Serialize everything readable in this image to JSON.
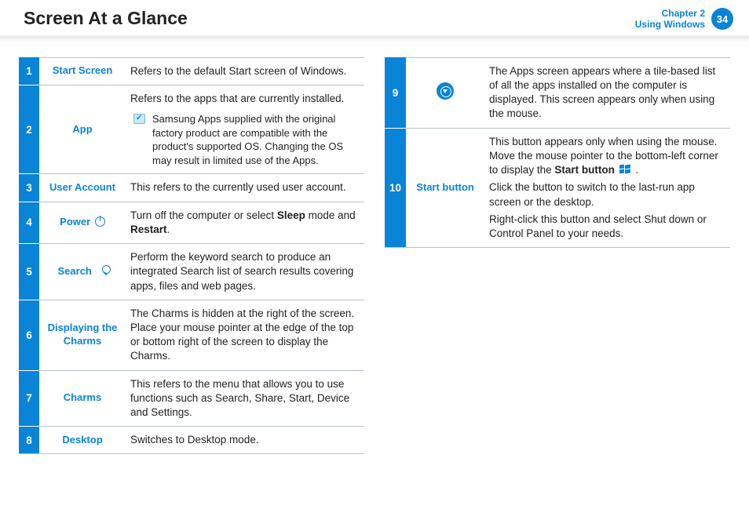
{
  "header": {
    "title": "Screen At a Glance",
    "chapter_line1": "Chapter 2",
    "chapter_line2": "Using Windows",
    "page": "34"
  },
  "left": [
    {
      "n": "1",
      "label": "Start Screen",
      "desc": "Refers to the default Start screen of Windows."
    },
    {
      "n": "2",
      "label": "App",
      "desc": "Refers to the apps that are currently installed.",
      "note": "Samsung Apps supplied with the original factory product are compatible with the product's supported OS. Changing the OS may result in limited use of the Apps."
    },
    {
      "n": "3",
      "label": "User Account",
      "desc": "This refers to the currently used user account."
    },
    {
      "n": "4",
      "label": "Power",
      "icon": "power",
      "desc_parts": [
        "Turn off the computer or select ",
        "Sleep",
        " mode and ",
        "Restart",
        "."
      ]
    },
    {
      "n": "5",
      "label": "Search",
      "icon": "search",
      "desc": "Perform the keyword search to produce an integrated Search list of search results covering apps, files and web pages."
    },
    {
      "n": "6",
      "label": "Displaying the Charms",
      "desc": "The Charms is hidden at the right of the screen. Place your mouse pointer at the edge of the top or bottom right of the screen to display the Charms."
    },
    {
      "n": "7",
      "label": "Charms",
      "desc": "This refers to the menu that allows you to use functions such as Search, Share, Start, Device and Settings."
    },
    {
      "n": "8",
      "label": "Desktop",
      "desc": "Switches to Desktop mode."
    }
  ],
  "right": [
    {
      "n": "9",
      "icon_label": "down-circle",
      "desc": "The Apps screen appears where a tile-based list of all the apps installed on the computer is displayed. This screen appears only when using the mouse."
    },
    {
      "n": "10",
      "label": "Start button",
      "p1a": "This button appears only when using the mouse. Move the mouse pointer to the bottom-left corner to display the ",
      "p1b": "Start button",
      "p1c": " .",
      "p2": "Click the button to switch to the last-run app screen or the desktop.",
      "p3": "Right-click this button and select Shut down or Control Panel to your needs."
    }
  ]
}
